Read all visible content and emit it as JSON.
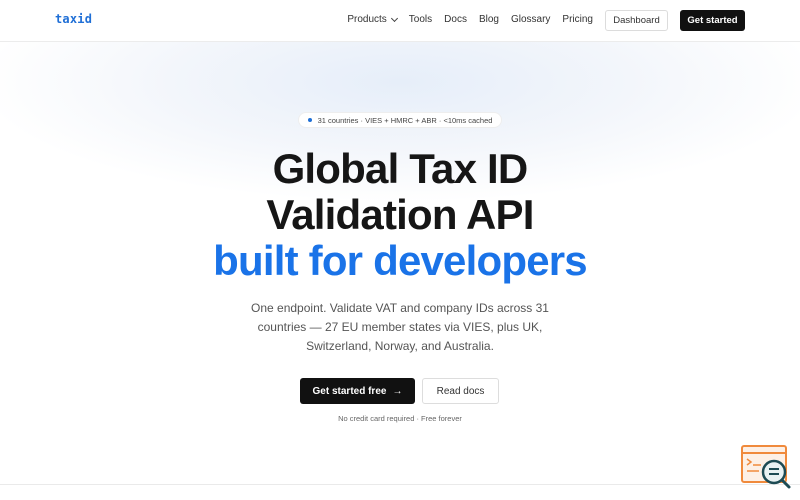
{
  "header": {
    "logo": "taxid",
    "nav": [
      {
        "label": "Products",
        "has_dropdown": true
      },
      {
        "label": "Tools"
      },
      {
        "label": "Docs"
      },
      {
        "label": "Blog"
      },
      {
        "label": "Glossary"
      },
      {
        "label": "Pricing"
      }
    ],
    "dashboard_label": "Dashboard",
    "get_started_label": "Get started"
  },
  "hero": {
    "badge": "31 countries · VIES + HMRC + ABR · <10ms cached",
    "headline_line1": "Global Tax ID",
    "headline_line2": "Validation API",
    "headline_line3": "built for developers",
    "subtitle": "One endpoint. Validate VAT and company IDs across 31 countries — 27 EU member states via VIES, plus UK, Switzerland, Norway, and Australia.",
    "primary_cta": "Get started free",
    "primary_cta_icon": "arrow-right-icon",
    "secondary_cta": "Read docs",
    "note": "No credit card required · Free forever"
  },
  "widget": {
    "icon": "terminal-search-icon"
  },
  "colors": {
    "accent": "#1a73e8",
    "dark": "#111111",
    "widget": "#f08a3c"
  }
}
